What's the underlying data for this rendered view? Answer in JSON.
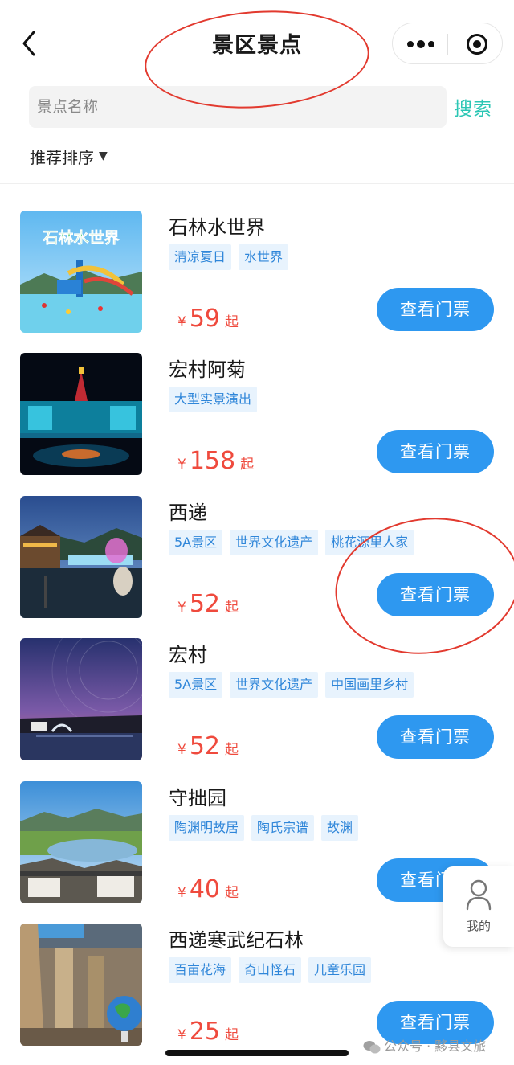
{
  "header": {
    "title": "景区景点"
  },
  "search": {
    "placeholder": "景点名称",
    "button_label": "搜索"
  },
  "sort": {
    "label": "推荐排序",
    "caret": "▼"
  },
  "spots": [
    {
      "name": "石林水世界",
      "tags": [
        "清凉夏日",
        "水世界"
      ],
      "currency": "¥",
      "price": "59",
      "price_suffix": "起",
      "button_label": "查看门票",
      "thumb_text": "石林水世界"
    },
    {
      "name": "宏村阿菊",
      "tags": [
        "大型实景演出"
      ],
      "currency": "¥",
      "price": "158",
      "price_suffix": "起",
      "button_label": "查看门票"
    },
    {
      "name": "西递",
      "tags": [
        "5A景区",
        "世界文化遗产",
        "桃花源里人家"
      ],
      "currency": "¥",
      "price": "52",
      "price_suffix": "起",
      "button_label": "查看门票"
    },
    {
      "name": "宏村",
      "tags": [
        "5A景区",
        "世界文化遗产",
        "中国画里乡村"
      ],
      "currency": "¥",
      "price": "52",
      "price_suffix": "起",
      "button_label": "查看门票"
    },
    {
      "name": "守拙园",
      "tags": [
        "陶渊明故居",
        "陶氏宗谱",
        "故渊"
      ],
      "currency": "¥",
      "price": "40",
      "price_suffix": "起",
      "button_label": "查看门票"
    },
    {
      "name": "西递寒武纪石林",
      "tags": [
        "百亩花海",
        "奇山怪石",
        "儿童乐园"
      ],
      "currency": "¥",
      "price": "25",
      "price_suffix": "起",
      "button_label": "查看门票"
    }
  ],
  "float_button": {
    "label": "我的"
  },
  "watermark": {
    "text": "公众号 · 黟县文旅"
  },
  "colors": {
    "accent_blue": "#2e98f0",
    "price_red": "#ef4a3d",
    "search_teal": "#2bc6b4",
    "tag_bg": "#e8f3fd",
    "tag_text": "#2f86d9",
    "annotation_red": "#e23a2f"
  }
}
